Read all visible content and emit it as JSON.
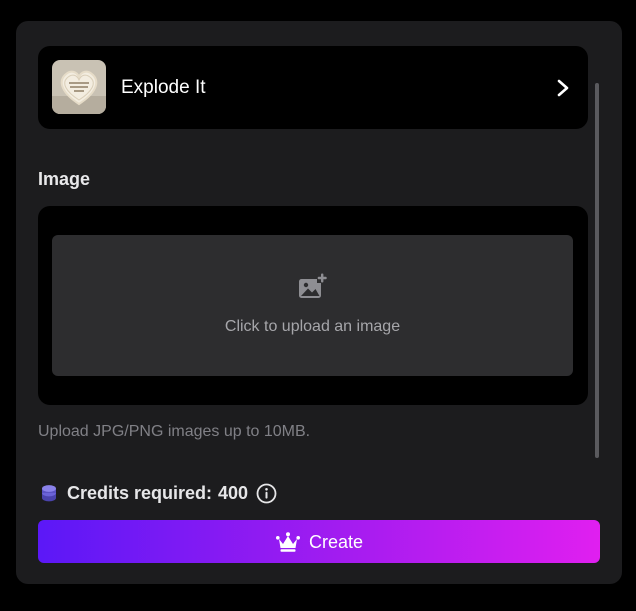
{
  "effect": {
    "title": "Explode It",
    "thumbnail_icon": "heart-cake-thumbnail",
    "chevron_icon": "chevron-right-icon"
  },
  "image_section": {
    "label": "Image",
    "upload_prompt": "Click to upload an image",
    "upload_icon": "add-image-icon",
    "hint": "Upload JPG/PNG images up to 10MB."
  },
  "credits": {
    "icon": "coins-stack-icon",
    "label": "Credits required:",
    "value": "400",
    "info_icon": "info-icon"
  },
  "create_button": {
    "label": "Create",
    "icon": "crown-icon"
  },
  "colors": {
    "panel_bg": "#1c1c1e",
    "card_bg": "#000000",
    "upload_bg": "#2d2d2f",
    "gradient_start": "#5b18f7",
    "gradient_end": "#e01ff0",
    "coin_accent": "#6b63d8"
  }
}
